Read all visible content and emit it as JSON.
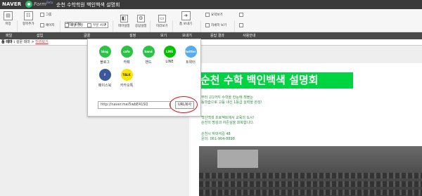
{
  "topbar": {
    "brand": "NAVER",
    "product": "Form",
    "beta": "Beta",
    "document_title": "순천 수학학원 백인백색 설명회"
  },
  "ribbon": {
    "save": "저장",
    "add_item": "항목추가",
    "group": "그룹",
    "page": "페이지",
    "font_select": "맑은 고딕",
    "item_settings": "개별 설정",
    "part_style": "부분 서식",
    "theme_settings": "테마설정",
    "response_settings": "응답설정",
    "preview": "미리보기",
    "send": "폼 보내기",
    "summary_view": "요약보기",
    "detail_view": "자세히 보기"
  },
  "sections": [
    "파일",
    "삽입",
    "글꼴",
    "설정",
    "보기",
    "보내기",
    "응답 결과",
    "사용안내"
  ],
  "breadcrumb": {
    "label": "폼 테마 :",
    "theme": "설문 테마",
    "separator": ">",
    "link": "미리보기"
  },
  "share_popup": {
    "items": [
      {
        "label": "블로그",
        "icon_text": "blog",
        "color": "#2bc245"
      },
      {
        "label": "카페",
        "icon_text": "cafe",
        "color": "#2bc245"
      },
      {
        "label": "밴드",
        "icon_text": "band",
        "color": "#2bc245"
      },
      {
        "label": "LINE",
        "icon_text": "LINE",
        "color": "#00c300"
      },
      {
        "label": "트위터",
        "icon_text": "twitter",
        "color": "#55acee"
      },
      {
        "label": "페이스북",
        "icon_text": "f",
        "color": "#3b5998"
      },
      {
        "label": "카카오톡",
        "icon_text": "TALK",
        "color": "#f7e600"
      }
    ],
    "url": "http://naver.me/5wbE41SQ",
    "copy_button": "URL복사"
  },
  "poster": {
    "title": "순천 수학 백인백색 설명회",
    "line1": "부터 고1까지 수학을 한눈에 책블는",
    "line2": "동학습으로 고등 내신 1등급 실력을 완성!",
    "line3": "백인백색 프로젝트에서 교육의 도시!",
    "line4": "순천의 명성과 자존심을 회복합니다.",
    "line5": "순천시 하대석길 48",
    "line6": "문의: 061-904-8898"
  },
  "colors": {
    "title_green": "#00d341",
    "text_green": "#2d8a3e",
    "highlight_red": "#e01010"
  }
}
